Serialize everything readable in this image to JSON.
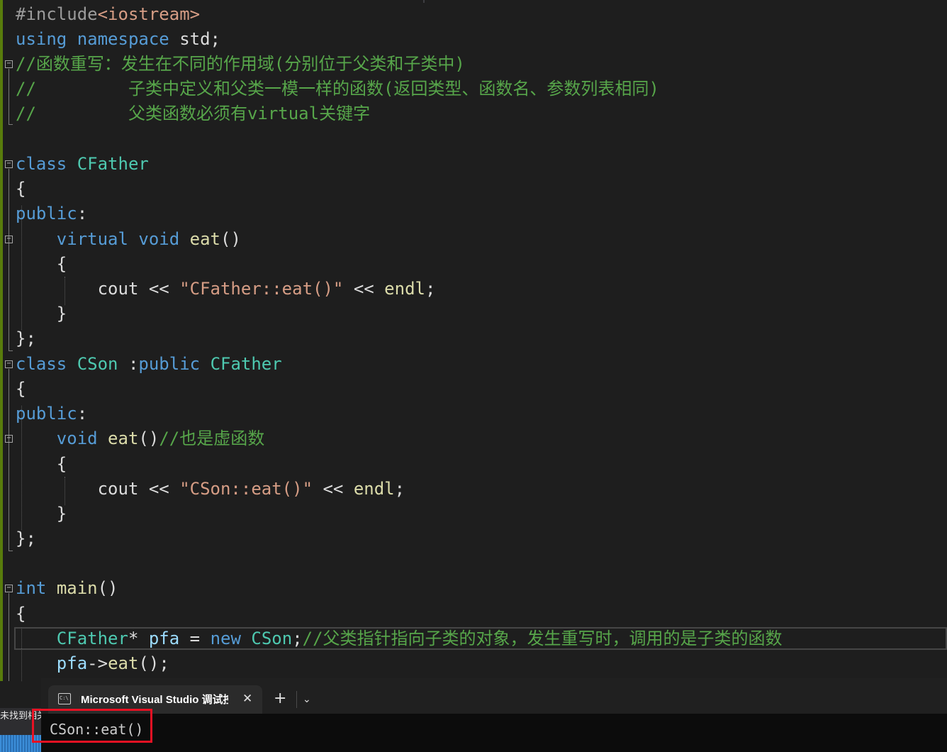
{
  "editor": {
    "lines": [
      {
        "segments": [
          {
            "t": "#include",
            "c": "pp"
          },
          {
            "t": "<iostream>",
            "c": "hd"
          }
        ]
      },
      {
        "segments": [
          {
            "t": "using",
            "c": "kw"
          },
          {
            "t": " ",
            "c": "pl"
          },
          {
            "t": "namespace",
            "c": "kw"
          },
          {
            "t": " std;",
            "c": "pl"
          }
        ]
      },
      {
        "segments": [
          {
            "t": "//函数重写：发生在不同的作用域(分别位于父类和子类中)",
            "c": "cm"
          }
        ]
      },
      {
        "segments": [
          {
            "t": "//         子类中定义和父类一模一样的函数(返回类型、函数名、参数列表相同)",
            "c": "cm"
          }
        ]
      },
      {
        "segments": [
          {
            "t": "//         父类函数必须有virtual关键字",
            "c": "cm"
          }
        ]
      },
      {
        "segments": []
      },
      {
        "segments": [
          {
            "t": "class",
            "c": "kw"
          },
          {
            "t": " ",
            "c": "pl"
          },
          {
            "t": "CFather",
            "c": "ty"
          }
        ]
      },
      {
        "segments": [
          {
            "t": "{",
            "c": "pl"
          }
        ]
      },
      {
        "segments": [
          {
            "t": "public",
            "c": "kw"
          },
          {
            "t": ":",
            "c": "pl"
          }
        ]
      },
      {
        "segments": [
          {
            "t": "    ",
            "c": "pl"
          },
          {
            "t": "virtual",
            "c": "kw"
          },
          {
            "t": " ",
            "c": "pl"
          },
          {
            "t": "void",
            "c": "kw"
          },
          {
            "t": " ",
            "c": "pl"
          },
          {
            "t": "eat",
            "c": "fn"
          },
          {
            "t": "()",
            "c": "pl"
          }
        ]
      },
      {
        "segments": [
          {
            "t": "    {",
            "c": "pl"
          }
        ]
      },
      {
        "segments": [
          {
            "t": "        cout << ",
            "c": "pl"
          },
          {
            "t": "\"CFather::eat()\"",
            "c": "str"
          },
          {
            "t": " << ",
            "c": "pl"
          },
          {
            "t": "endl",
            "c": "fn"
          },
          {
            "t": ";",
            "c": "pl"
          }
        ]
      },
      {
        "segments": [
          {
            "t": "    }",
            "c": "pl"
          }
        ]
      },
      {
        "segments": [
          {
            "t": "};",
            "c": "pl"
          }
        ]
      },
      {
        "segments": [
          {
            "t": "class",
            "c": "kw"
          },
          {
            "t": " ",
            "c": "pl"
          },
          {
            "t": "CSon",
            "c": "ty"
          },
          {
            "t": " :",
            "c": "pl"
          },
          {
            "t": "public",
            "c": "kw"
          },
          {
            "t": " ",
            "c": "pl"
          },
          {
            "t": "CFather",
            "c": "ty"
          }
        ]
      },
      {
        "segments": [
          {
            "t": "{",
            "c": "pl"
          }
        ]
      },
      {
        "segments": [
          {
            "t": "public",
            "c": "kw"
          },
          {
            "t": ":",
            "c": "pl"
          }
        ]
      },
      {
        "segments": [
          {
            "t": "    ",
            "c": "pl"
          },
          {
            "t": "void",
            "c": "kw"
          },
          {
            "t": " ",
            "c": "pl"
          },
          {
            "t": "eat",
            "c": "fn"
          },
          {
            "t": "()",
            "c": "pl"
          },
          {
            "t": "//也是虚函数",
            "c": "cm"
          }
        ]
      },
      {
        "segments": [
          {
            "t": "    {",
            "c": "pl"
          }
        ]
      },
      {
        "segments": [
          {
            "t": "        cout << ",
            "c": "pl"
          },
          {
            "t": "\"CSon::eat()\"",
            "c": "str"
          },
          {
            "t": " << ",
            "c": "pl"
          },
          {
            "t": "endl",
            "c": "fn"
          },
          {
            "t": ";",
            "c": "pl"
          }
        ]
      },
      {
        "segments": [
          {
            "t": "    }",
            "c": "pl"
          }
        ]
      },
      {
        "segments": [
          {
            "t": "};",
            "c": "pl"
          }
        ]
      },
      {
        "segments": []
      },
      {
        "segments": [
          {
            "t": "int",
            "c": "kw"
          },
          {
            "t": " ",
            "c": "pl"
          },
          {
            "t": "main",
            "c": "fn"
          },
          {
            "t": "()",
            "c": "pl"
          }
        ]
      },
      {
        "segments": [
          {
            "t": "{",
            "c": "pl"
          }
        ]
      },
      {
        "segments": [
          {
            "t": "    ",
            "c": "pl"
          },
          {
            "t": "CFather",
            "c": "ty"
          },
          {
            "t": "* ",
            "c": "pl"
          },
          {
            "t": "pfa",
            "c": "var"
          },
          {
            "t": " = ",
            "c": "pl"
          },
          {
            "t": "new",
            "c": "kw"
          },
          {
            "t": " ",
            "c": "pl"
          },
          {
            "t": "CSon",
            "c": "ty"
          },
          {
            "t": ";",
            "c": "pl"
          },
          {
            "t": "//父类指针指向子类的对象，发生重写时，调用的是子类的函数",
            "c": "cm"
          }
        ]
      },
      {
        "segments": [
          {
            "t": "    ",
            "c": "pl"
          },
          {
            "t": "pfa",
            "c": "var"
          },
          {
            "t": "->",
            "c": "pl"
          },
          {
            "t": "eat",
            "c": "fn"
          },
          {
            "t": "();",
            "c": "pl"
          }
        ]
      }
    ],
    "fold_markers": [
      "−",
      "−",
      "−",
      "−",
      "−",
      "−"
    ]
  },
  "terminal": {
    "tab_title": "Microsoft Visual Studio 调试控制台",
    "tab_icon_text": "C:\\",
    "close_glyph": "✕",
    "new_tab_glyph": "+",
    "dropdown_glyph": "⌄",
    "output": "CSon::eat()"
  },
  "left_fragment": {
    "text": "未找到相关问题"
  },
  "colors": {
    "background": "#1e1e1e",
    "keyword": "#569cd6",
    "type": "#4ec9b0",
    "function": "#dcdcaa",
    "string": "#d69d85",
    "comment": "#57a64a",
    "highlight_box": "#e81123"
  }
}
